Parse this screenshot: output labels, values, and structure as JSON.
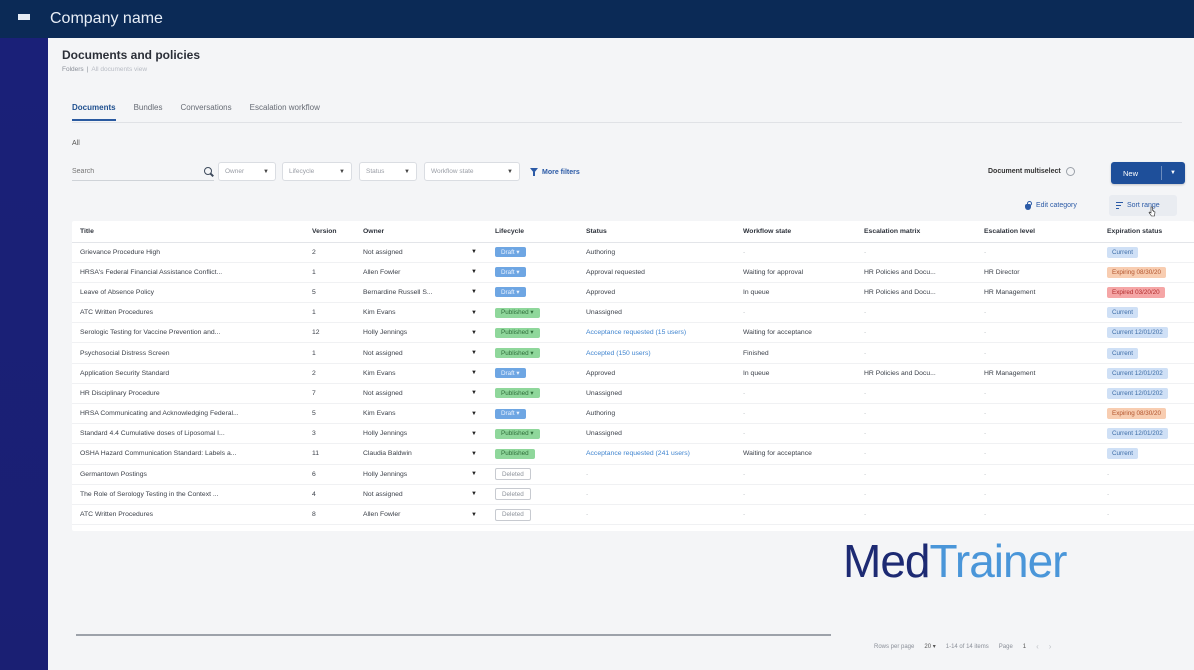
{
  "app": {
    "company_name": "Company name",
    "menu_icon": "hamburger-menu-icon"
  },
  "page": {
    "title": "Documents and policies",
    "breadcrumb": [
      "Folders",
      "All documents view"
    ]
  },
  "tabs": [
    {
      "label": "Documents",
      "active": true
    },
    {
      "label": "Bundles",
      "active": false
    },
    {
      "label": "Conversations",
      "active": false
    },
    {
      "label": "Escalation workflow",
      "active": false
    }
  ],
  "section_label": "All",
  "search": {
    "placeholder": "Search"
  },
  "filters": [
    {
      "label": "Owner"
    },
    {
      "label": "Lifecycle"
    },
    {
      "label": "Status"
    },
    {
      "label": "Workflow state"
    }
  ],
  "more_filters_label": "More filters",
  "multiselect_label": "Document multiselect",
  "new_button_label": "New",
  "edit_category_label": "Edit category",
  "sort_label": "Sort  range",
  "columns": [
    "Title",
    "Version",
    "Owner",
    "Lifecycle",
    "Status",
    "Workflow state",
    "Escalation matrix",
    "Escalation level",
    "Expiration status"
  ],
  "rows": [
    {
      "title": "Grievance Procedure High",
      "version": "2",
      "owner": "Not assigned",
      "lifecycle": "Draft",
      "lc_type": "draft",
      "status": "Authoring",
      "status_link": false,
      "workflow": "-",
      "matrix": "-",
      "level": "-",
      "expiration": "Current",
      "exp_type": "current"
    },
    {
      "title": "HRSA's Federal Financial Assistance Conflict...",
      "version": "1",
      "owner": "Allen Fowler",
      "lifecycle": "Draft",
      "lc_type": "draft",
      "status": "Approval requested",
      "status_link": false,
      "workflow": "Waiting for approval",
      "matrix": "HR Policies and Docu...",
      "level": "HR Director",
      "expiration": "Expiring 08/30/20",
      "exp_type": "expiring"
    },
    {
      "title": "Leave of Absence Policy",
      "version": "5",
      "owner": "Bernardine Russell S...",
      "lifecycle": "Draft",
      "lc_type": "draft",
      "status": "Approved",
      "status_link": false,
      "workflow": "In queue",
      "matrix": "HR Policies and Docu...",
      "level": "HR Management",
      "expiration": "Expired 03/20/20",
      "exp_type": "expired"
    },
    {
      "title": "ATC Written Procedures",
      "version": "1",
      "owner": "Kim Evans",
      "lifecycle": "Published",
      "lc_type": "published",
      "status": "Unassigned",
      "status_link": false,
      "workflow": "-",
      "matrix": "-",
      "level": "-",
      "expiration": "Current",
      "exp_type": "current"
    },
    {
      "title": "Serologic Testing for Vaccine Prevention and...",
      "version": "12",
      "owner": "Holly Jennings",
      "lifecycle": "Published",
      "lc_type": "published",
      "status": "Acceptance requested (15 users)",
      "status_link": true,
      "workflow": "Waiting for acceptance",
      "matrix": "-",
      "level": "-",
      "expiration": "Current 12/01/202",
      "exp_type": "current"
    },
    {
      "title": "Psychosocial Distress Screen",
      "version": "1",
      "owner": "Not assigned",
      "lifecycle": "Published",
      "lc_type": "published",
      "status": "Accepted (150 users)",
      "status_link": true,
      "workflow": "Finished",
      "matrix": "-",
      "level": "-",
      "expiration": "Current",
      "exp_type": "current"
    },
    {
      "title": "Application Security Standard",
      "version": "2",
      "owner": "Kim Evans",
      "lifecycle": "Draft",
      "lc_type": "draft",
      "status": "Approved",
      "status_link": false,
      "workflow": "In queue",
      "matrix": "HR Policies and Docu...",
      "level": "HR Management",
      "expiration": "Current 12/01/202",
      "exp_type": "current"
    },
    {
      "title": "HR Disciplinary Procedure",
      "version": "7",
      "owner": "Not assigned",
      "lifecycle": "Published",
      "lc_type": "published",
      "status": "Unassigned",
      "status_link": false,
      "workflow": "-",
      "matrix": "-",
      "level": "-",
      "expiration": "Current 12/01/202",
      "exp_type": "current"
    },
    {
      "title": "HRSA Communicating and Acknowledging Federal...",
      "version": "5",
      "owner": "Kim Evans",
      "lifecycle": "Draft",
      "lc_type": "draft",
      "status": "Authoring",
      "status_link": false,
      "workflow": "-",
      "matrix": "-",
      "level": "-",
      "expiration": "Expiring 08/30/20",
      "exp_type": "expiring"
    },
    {
      "title": "Standard 4.4 Cumulative doses of Liposomal I...",
      "version": "3",
      "owner": "Holly Jennings",
      "lifecycle": "Published",
      "lc_type": "published",
      "status": "Unassigned",
      "status_link": false,
      "workflow": "-",
      "matrix": "-",
      "level": "-",
      "expiration": "Current 12/01/202",
      "exp_type": "current"
    },
    {
      "title": "OSHA Hazard Communication Standard: Labels a...",
      "version": "11",
      "owner": "Claudia Baldwin",
      "lifecycle": "Published",
      "lc_type": "published",
      "status": "Acceptance requested (241 users)",
      "status_link": true,
      "workflow": "Waiting for acceptance",
      "matrix": "-",
      "level": "-",
      "expiration": "Current",
      "exp_type": "current"
    },
    {
      "title": "Germantown Postings",
      "version": "6",
      "owner": "Holly Jennings",
      "lifecycle": "Deleted",
      "lc_type": "deleted",
      "status": "-",
      "status_link": false,
      "workflow": "-",
      "matrix": "-",
      "level": "-",
      "expiration": "-",
      "exp_type": "none"
    },
    {
      "title": "The Role of Serology Testing in the Context ...",
      "version": "4",
      "owner": "Not assigned",
      "lifecycle": "Deleted",
      "lc_type": "deleted",
      "status": "-",
      "status_link": false,
      "workflow": "-",
      "matrix": "-",
      "level": "-",
      "expiration": "-",
      "exp_type": "none"
    },
    {
      "title": "ATC Written Procedures",
      "version": "8",
      "owner": "Allen Fowler",
      "lifecycle": "Deleted",
      "lc_type": "deleted",
      "status": "-",
      "status_link": false,
      "workflow": "-",
      "matrix": "-",
      "level": "-",
      "expiration": "-",
      "exp_type": "none"
    }
  ],
  "pagination": {
    "rows_label": "Rows per page",
    "rows_value": "20",
    "range_label": "1-14 of 14 items",
    "page_label": "Page",
    "page_value": "1"
  },
  "watermark": {
    "part1": "Med",
    "part2": "Trainer",
    "color1": "#1d2a73",
    "color2": "#4a96d9"
  },
  "colors": {
    "topbar": "#0b2a56",
    "accent": "#1e4f9a",
    "draft": "#6ea6e3",
    "published": "#8fd79b",
    "expiring": "#f8cdb1",
    "expired": "#f5a6a6",
    "current": "#cfe0f6"
  }
}
